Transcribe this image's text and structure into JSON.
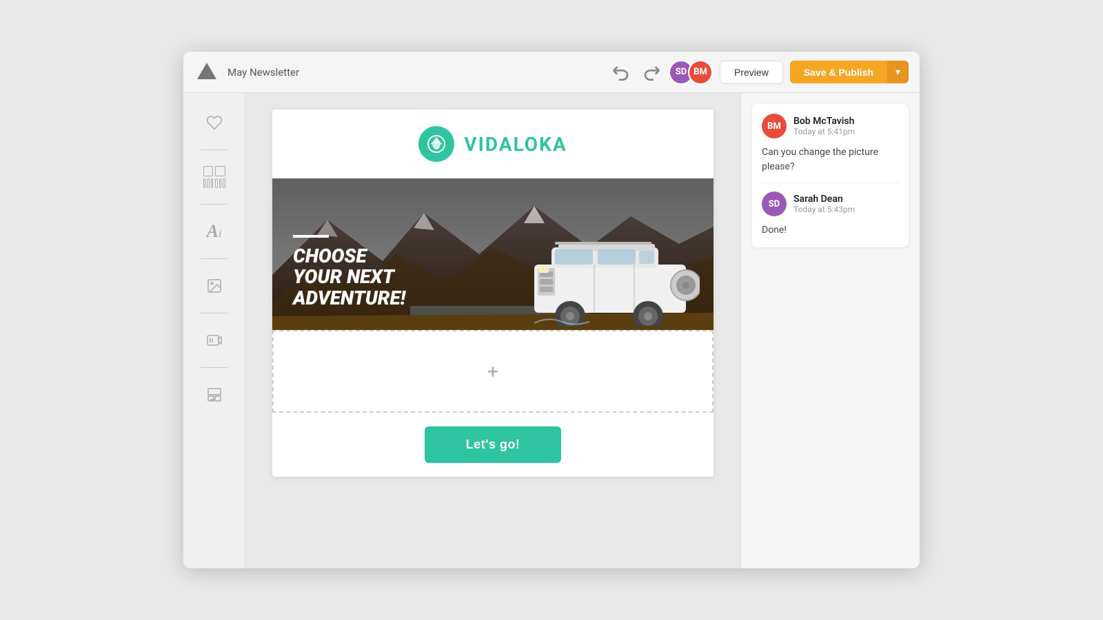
{
  "app": {
    "title": "May Newsletter"
  },
  "header": {
    "title": "May Newsletter",
    "preview_label": "Preview",
    "save_publish_label": "Save & Publish",
    "avatar_sd_initials": "SD",
    "avatar_bm_initials": "BM",
    "undo_label": "Undo",
    "redo_label": "Redo",
    "dropdown_arrow": "▾"
  },
  "sidebar": {
    "favorite_icon": "heart",
    "layout_icon": "layout",
    "text_icon": "Ai",
    "image_icon": "image",
    "video_icon": "video",
    "widget_icon": "widget"
  },
  "email": {
    "brand_name": "VIDALOKA",
    "hero_headline_line1": "Choose",
    "hero_headline_line2": "Your Next",
    "hero_headline_line3": "Adventure!",
    "cta_label": "Let's go!",
    "add_block_plus": "+"
  },
  "comments": [
    {
      "id": "bm",
      "initials": "BM",
      "author": "Bob McTavish",
      "time": "Today at 5:41pm",
      "text": "Can you change the picture please?"
    },
    {
      "id": "sd",
      "initials": "SD",
      "author": "Sarah Dean",
      "time": "Today at 5:43pm",
      "text": "Done!"
    }
  ],
  "colors": {
    "brand_teal": "#2ec4a0",
    "avatar_purple": "#9b59b6",
    "avatar_red": "#e74c3c",
    "save_orange": "#f5a623"
  }
}
